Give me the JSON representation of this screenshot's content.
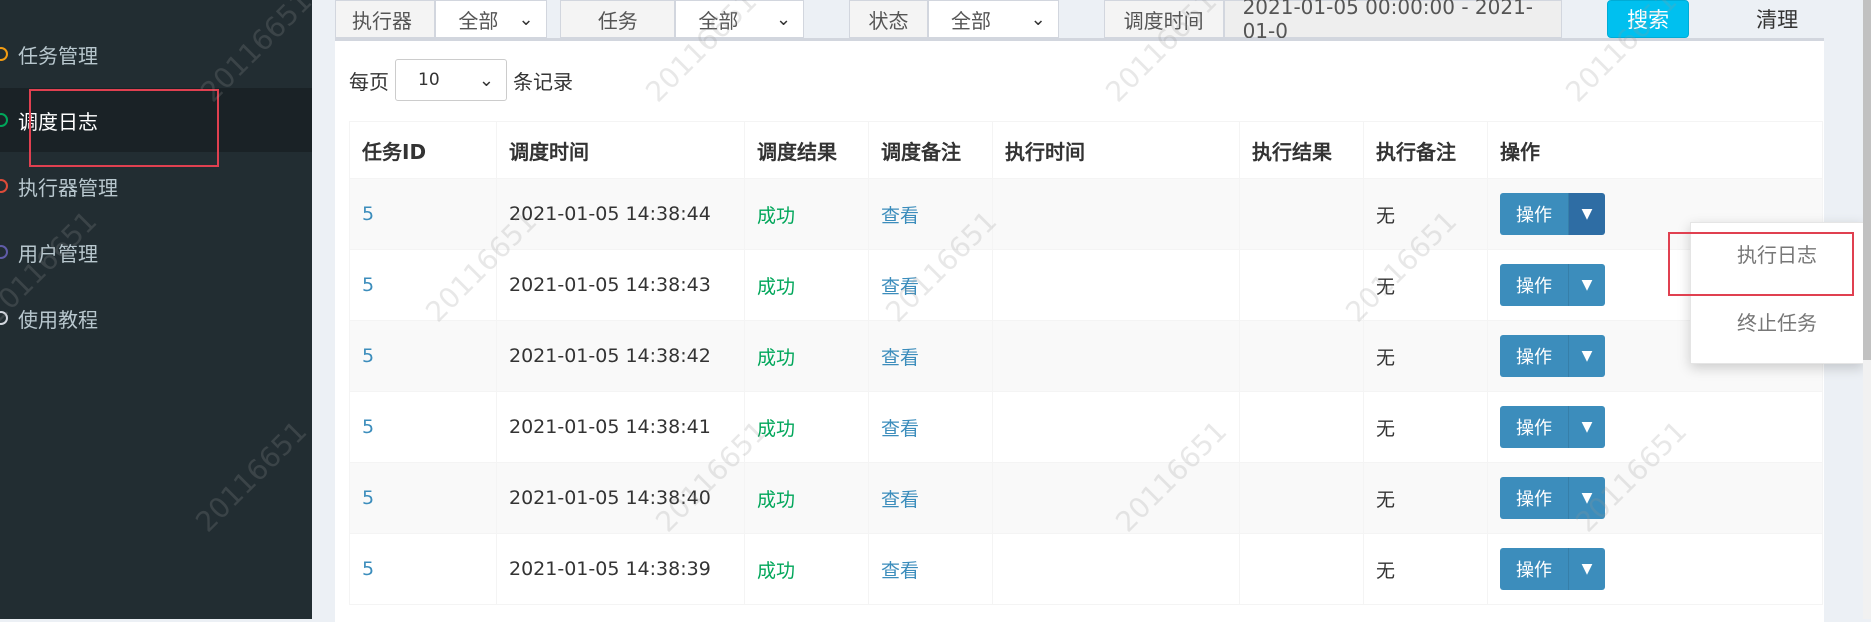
{
  "sidebar": {
    "items": [
      {
        "label": "任务管理",
        "dot_color": "#f39c12"
      },
      {
        "label": "调度日志",
        "dot_color": "#00a65a",
        "active": true
      },
      {
        "label": "执行器管理",
        "dot_color": "#dd4b39"
      },
      {
        "label": "用户管理",
        "dot_color": "#605ca8"
      },
      {
        "label": "使用教程",
        "dot_color": "#d2d6de"
      }
    ]
  },
  "filters": {
    "executor_label": "执行器",
    "executor_value": "全部",
    "task_label": "任务",
    "task_value": "全部",
    "status_label": "状态",
    "status_value": "全部",
    "time_label": "调度时间",
    "time_value": "2021-01-05 00:00:00 - 2021-01-0",
    "search_label": "搜索",
    "clear_label": "清理"
  },
  "length": {
    "prefix": "每页",
    "value": "10",
    "suffix": "条记录"
  },
  "table": {
    "headers": [
      "任务ID",
      "调度时间",
      "调度结果",
      "调度备注",
      "执行时间",
      "执行结果",
      "执行备注",
      "操作"
    ],
    "rows": [
      {
        "id": "5",
        "trigger_time": "2021-01-05 14:38:44",
        "trigger_result": "成功",
        "trigger_msg": "查看",
        "handle_time": "",
        "handle_result": "",
        "handle_msg": "无",
        "op": "操作"
      },
      {
        "id": "5",
        "trigger_time": "2021-01-05 14:38:43",
        "trigger_result": "成功",
        "trigger_msg": "查看",
        "handle_time": "",
        "handle_result": "",
        "handle_msg": "无",
        "op": "操作"
      },
      {
        "id": "5",
        "trigger_time": "2021-01-05 14:38:42",
        "trigger_result": "成功",
        "trigger_msg": "查看",
        "handle_time": "",
        "handle_result": "",
        "handle_msg": "无",
        "op": "操作"
      },
      {
        "id": "5",
        "trigger_time": "2021-01-05 14:38:41",
        "trigger_result": "成功",
        "trigger_msg": "查看",
        "handle_time": "",
        "handle_result": "",
        "handle_msg": "无",
        "op": "操作"
      },
      {
        "id": "5",
        "trigger_time": "2021-01-05 14:38:40",
        "trigger_result": "成功",
        "trigger_msg": "查看",
        "handle_time": "",
        "handle_result": "",
        "handle_msg": "无",
        "op": "操作"
      },
      {
        "id": "5",
        "trigger_time": "2021-01-05 14:38:39",
        "trigger_result": "成功",
        "trigger_msg": "查看",
        "handle_time": "",
        "handle_result": "",
        "handle_msg": "无",
        "op": "操作"
      }
    ]
  },
  "dropdown": {
    "items": [
      "执行日志",
      "终止任务"
    ]
  },
  "watermark": "20116651",
  "colors": {
    "sidebar_bg": "#222d32",
    "link": "#3c8dbc",
    "success": "#00a65a",
    "search_button": "#00c0ef",
    "highlight": "#e04050"
  }
}
